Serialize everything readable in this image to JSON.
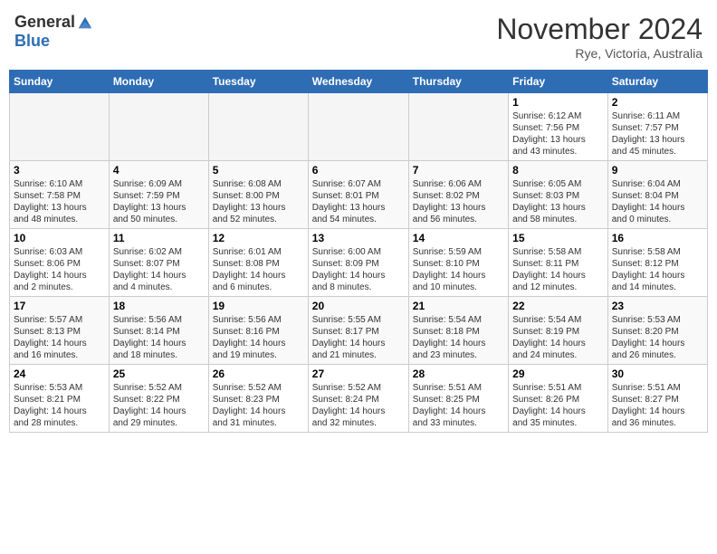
{
  "header": {
    "logo_general": "General",
    "logo_blue": "Blue",
    "month_title": "November 2024",
    "location": "Rye, Victoria, Australia"
  },
  "weekdays": [
    "Sunday",
    "Monday",
    "Tuesday",
    "Wednesday",
    "Thursday",
    "Friday",
    "Saturday"
  ],
  "weeks": [
    [
      {
        "num": "",
        "info": ""
      },
      {
        "num": "",
        "info": ""
      },
      {
        "num": "",
        "info": ""
      },
      {
        "num": "",
        "info": ""
      },
      {
        "num": "",
        "info": ""
      },
      {
        "num": "1",
        "info": "Sunrise: 6:12 AM\nSunset: 7:56 PM\nDaylight: 13 hours\nand 43 minutes."
      },
      {
        "num": "2",
        "info": "Sunrise: 6:11 AM\nSunset: 7:57 PM\nDaylight: 13 hours\nand 45 minutes."
      }
    ],
    [
      {
        "num": "3",
        "info": "Sunrise: 6:10 AM\nSunset: 7:58 PM\nDaylight: 13 hours\nand 48 minutes."
      },
      {
        "num": "4",
        "info": "Sunrise: 6:09 AM\nSunset: 7:59 PM\nDaylight: 13 hours\nand 50 minutes."
      },
      {
        "num": "5",
        "info": "Sunrise: 6:08 AM\nSunset: 8:00 PM\nDaylight: 13 hours\nand 52 minutes."
      },
      {
        "num": "6",
        "info": "Sunrise: 6:07 AM\nSunset: 8:01 PM\nDaylight: 13 hours\nand 54 minutes."
      },
      {
        "num": "7",
        "info": "Sunrise: 6:06 AM\nSunset: 8:02 PM\nDaylight: 13 hours\nand 56 minutes."
      },
      {
        "num": "8",
        "info": "Sunrise: 6:05 AM\nSunset: 8:03 PM\nDaylight: 13 hours\nand 58 minutes."
      },
      {
        "num": "9",
        "info": "Sunrise: 6:04 AM\nSunset: 8:04 PM\nDaylight: 14 hours\nand 0 minutes."
      }
    ],
    [
      {
        "num": "10",
        "info": "Sunrise: 6:03 AM\nSunset: 8:06 PM\nDaylight: 14 hours\nand 2 minutes."
      },
      {
        "num": "11",
        "info": "Sunrise: 6:02 AM\nSunset: 8:07 PM\nDaylight: 14 hours\nand 4 minutes."
      },
      {
        "num": "12",
        "info": "Sunrise: 6:01 AM\nSunset: 8:08 PM\nDaylight: 14 hours\nand 6 minutes."
      },
      {
        "num": "13",
        "info": "Sunrise: 6:00 AM\nSunset: 8:09 PM\nDaylight: 14 hours\nand 8 minutes."
      },
      {
        "num": "14",
        "info": "Sunrise: 5:59 AM\nSunset: 8:10 PM\nDaylight: 14 hours\nand 10 minutes."
      },
      {
        "num": "15",
        "info": "Sunrise: 5:58 AM\nSunset: 8:11 PM\nDaylight: 14 hours\nand 12 minutes."
      },
      {
        "num": "16",
        "info": "Sunrise: 5:58 AM\nSunset: 8:12 PM\nDaylight: 14 hours\nand 14 minutes."
      }
    ],
    [
      {
        "num": "17",
        "info": "Sunrise: 5:57 AM\nSunset: 8:13 PM\nDaylight: 14 hours\nand 16 minutes."
      },
      {
        "num": "18",
        "info": "Sunrise: 5:56 AM\nSunset: 8:14 PM\nDaylight: 14 hours\nand 18 minutes."
      },
      {
        "num": "19",
        "info": "Sunrise: 5:56 AM\nSunset: 8:16 PM\nDaylight: 14 hours\nand 19 minutes."
      },
      {
        "num": "20",
        "info": "Sunrise: 5:55 AM\nSunset: 8:17 PM\nDaylight: 14 hours\nand 21 minutes."
      },
      {
        "num": "21",
        "info": "Sunrise: 5:54 AM\nSunset: 8:18 PM\nDaylight: 14 hours\nand 23 minutes."
      },
      {
        "num": "22",
        "info": "Sunrise: 5:54 AM\nSunset: 8:19 PM\nDaylight: 14 hours\nand 24 minutes."
      },
      {
        "num": "23",
        "info": "Sunrise: 5:53 AM\nSunset: 8:20 PM\nDaylight: 14 hours\nand 26 minutes."
      }
    ],
    [
      {
        "num": "24",
        "info": "Sunrise: 5:53 AM\nSunset: 8:21 PM\nDaylight: 14 hours\nand 28 minutes."
      },
      {
        "num": "25",
        "info": "Sunrise: 5:52 AM\nSunset: 8:22 PM\nDaylight: 14 hours\nand 29 minutes."
      },
      {
        "num": "26",
        "info": "Sunrise: 5:52 AM\nSunset: 8:23 PM\nDaylight: 14 hours\nand 31 minutes."
      },
      {
        "num": "27",
        "info": "Sunrise: 5:52 AM\nSunset: 8:24 PM\nDaylight: 14 hours\nand 32 minutes."
      },
      {
        "num": "28",
        "info": "Sunrise: 5:51 AM\nSunset: 8:25 PM\nDaylight: 14 hours\nand 33 minutes."
      },
      {
        "num": "29",
        "info": "Sunrise: 5:51 AM\nSunset: 8:26 PM\nDaylight: 14 hours\nand 35 minutes."
      },
      {
        "num": "30",
        "info": "Sunrise: 5:51 AM\nSunset: 8:27 PM\nDaylight: 14 hours\nand 36 minutes."
      }
    ]
  ]
}
